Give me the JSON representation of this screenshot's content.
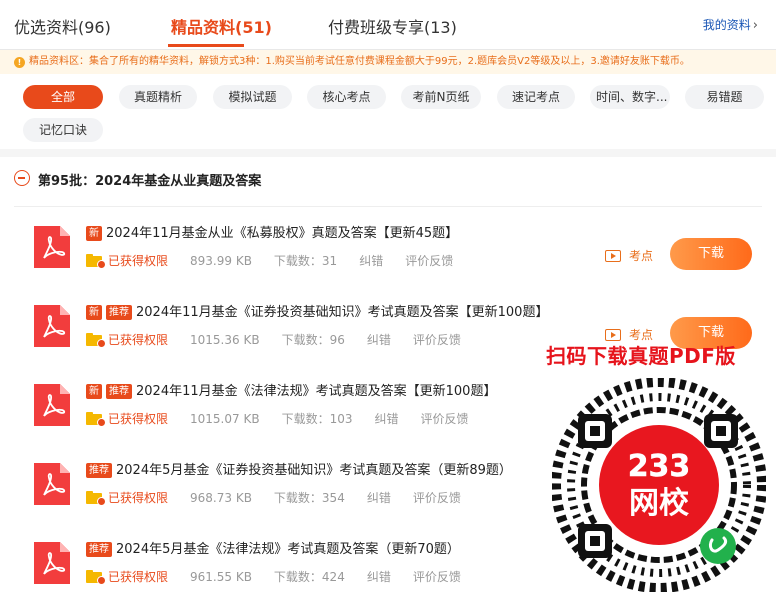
{
  "tabs": [
    {
      "label": "优选资料(96)"
    },
    {
      "label": "精品资料(51)"
    },
    {
      "label": "付费班级专享(13)"
    }
  ],
  "my_materials": "我的资料",
  "notice": "精品资料区：集合了所有的精华资料，解锁方式3种：1.购买当前考试任意付费课程金额大于99元，2.题库会员V2等级及以上，3.邀请好友账下载币。",
  "filters": [
    "全部",
    "真题精析",
    "模拟试题",
    "核心考点",
    "考前N页纸",
    "速记考点",
    "时间、数字...",
    "易错题",
    "记忆口诀"
  ],
  "batch_title": "第95批：2024年基金从业真题及答案",
  "items": [
    {
      "badges": [
        "新"
      ],
      "title": "2024年11月基金从业《私募股权》真题及答案【更新45题】",
      "permission": "已获得权限",
      "size": "893.99 KB",
      "downloads": "下载数：31",
      "report": "纠错",
      "feedback": "评价反馈",
      "kaodian": "考点",
      "download": "下载"
    },
    {
      "badges": [
        "新",
        "推荐"
      ],
      "title": "2024年11月基金《证券投资基础知识》考试真题及答案【更新100题】",
      "permission": "已获得权限",
      "size": "1015.36 KB",
      "downloads": "下载数：96",
      "report": "纠错",
      "feedback": "评价反馈",
      "kaodian": "考点",
      "download": "下载"
    },
    {
      "badges": [
        "新",
        "推荐"
      ],
      "title": "2024年11月基金《法律法规》考试真题及答案【更新100题】",
      "permission": "已获得权限",
      "size": "1015.07 KB",
      "downloads": "下载数：103",
      "report": "纠错",
      "feedback": "评价反馈"
    },
    {
      "badges": [
        "推荐"
      ],
      "title": "2024年5月基金《证券投资基础知识》考试真题及答案（更新89题）",
      "permission": "已获得权限",
      "size": "968.73 KB",
      "downloads": "下载数：354",
      "report": "纠错",
      "feedback": "评价反馈"
    },
    {
      "badges": [
        "推荐"
      ],
      "title": "2024年5月基金《法律法规》考试真题及答案（更新70题）",
      "permission": "已获得权限",
      "size": "961.55 KB",
      "downloads": "下载数：424",
      "report": "纠错",
      "feedback": "评价反馈"
    }
  ],
  "promo": {
    "text": "扫码下载真题PDF版",
    "qr_top": "233",
    "qr_bottom": "网校"
  },
  "colors": {
    "accent": "#e84a1b",
    "promo_red": "#e6141c",
    "button": "#ff7a2a"
  }
}
